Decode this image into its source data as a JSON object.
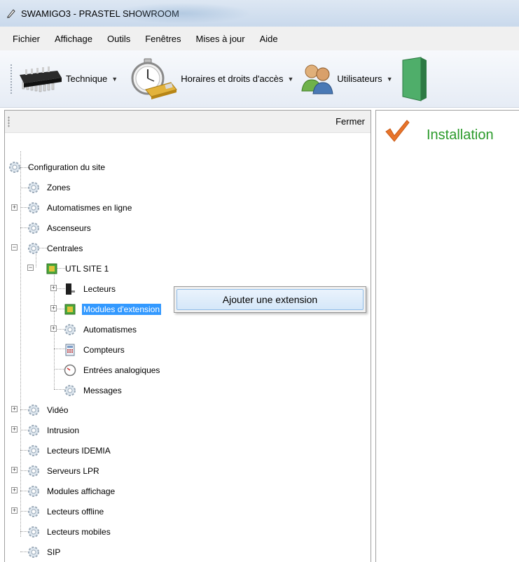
{
  "window": {
    "title": "SWAMIGO3 - PRASTEL SHOWROOM"
  },
  "menubar": {
    "items": [
      "Fichier",
      "Affichage",
      "Outils",
      "Fenêtres",
      "Mises à jour",
      "Aide"
    ]
  },
  "toolbar": {
    "buttons": [
      {
        "label": "Technique",
        "icon": "chip-icon"
      },
      {
        "label": "Horaires et droits d'accès",
        "icon": "stopwatch-icon"
      },
      {
        "label": "Utilisateurs",
        "icon": "users-icon"
      }
    ]
  },
  "left_panel": {
    "close_label": "Fermer"
  },
  "tree": {
    "root": "Configuration du site",
    "zones": "Zones",
    "automatismes_en_ligne": "Automatismes en ligne",
    "ascenseurs": "Ascenseurs",
    "centrales": "Centrales",
    "utl_site": "UTL SITE 1",
    "lecteurs": "Lecteurs",
    "modules_extension": "Modules d'extension",
    "automatismes": "Automatismes",
    "compteurs": "Compteurs",
    "entrees_analogiques": "Entrées analogiques",
    "messages": "Messages",
    "video": "Vidéo",
    "intrusion": "Intrusion",
    "lecteurs_idemia": "Lecteurs IDEMIA",
    "serveurs_lpr": "Serveurs LPR",
    "modules_affichage": "Modules affichage",
    "lecteurs_offline": "Lecteurs offline",
    "lecteurs_mobiles": "Lecteurs mobiles",
    "sip": "SIP"
  },
  "context_menu": {
    "item": "Ajouter une extension"
  },
  "right_panel": {
    "heading": "Installation",
    "accent_color": "#2a9a2a"
  }
}
